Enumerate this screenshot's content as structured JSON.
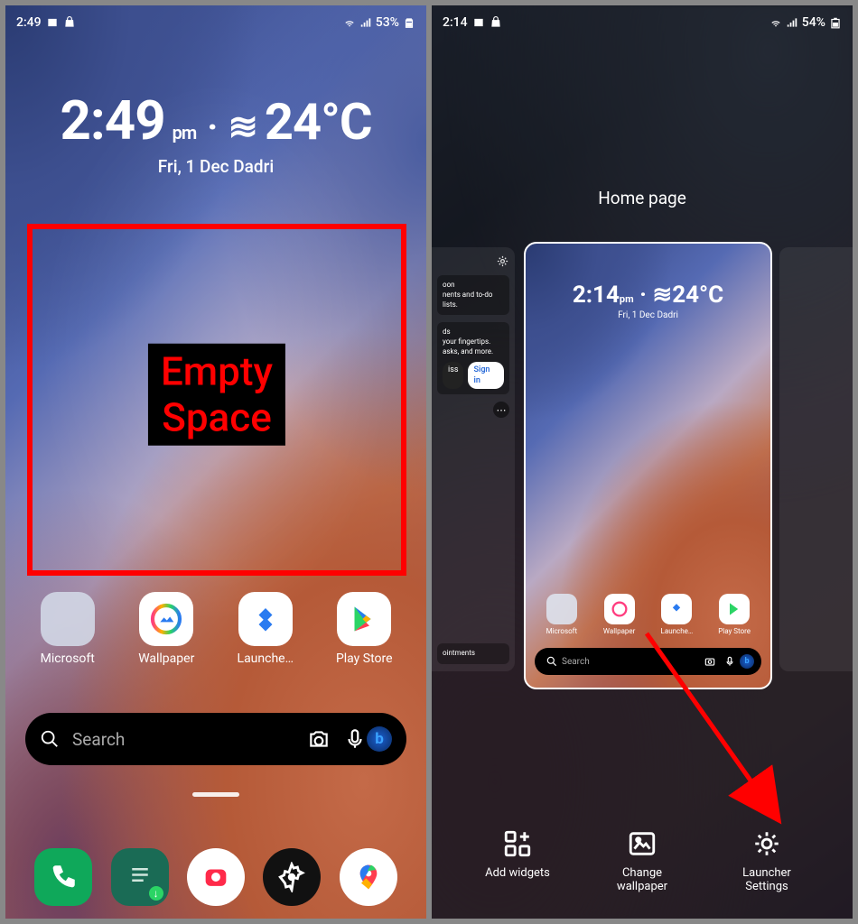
{
  "left": {
    "status": {
      "time": "2:49",
      "battery": "53%"
    },
    "clock": {
      "time": "2:49",
      "ampm": "pm",
      "temp": "24°C",
      "date": "Fri, 1 Dec  Dadri"
    },
    "empty_label": "Empty\nSpace",
    "apps": [
      {
        "label": "Microsoft"
      },
      {
        "label": "Wallpaper"
      },
      {
        "label": "Launche…"
      },
      {
        "label": "Play Store"
      }
    ],
    "search_placeholder": "Search"
  },
  "right": {
    "status": {
      "time": "2:14",
      "battery": "54%"
    },
    "title": "Home page",
    "feed": {
      "panel1_line1": "oon",
      "panel1_line2": "nents and to-do lists.",
      "panel2_title": "ds",
      "panel2_line2": "your fingertips.",
      "panel2_line3": "asks, and more.",
      "dismiss": "iss",
      "signin": "Sign in",
      "appt": "ointments"
    },
    "mini_clock": {
      "time": "2:14",
      "ampm": "pm",
      "temp": "24°C",
      "date": "Fri, 1 Dec  Dadri"
    },
    "mini_apps": [
      {
        "label": "Microsoft"
      },
      {
        "label": "Wallpaper"
      },
      {
        "label": "Launche…"
      },
      {
        "label": "Play Store"
      }
    ],
    "mini_search": "Search",
    "options": {
      "add_widgets": "Add widgets",
      "change_wallpaper": "Change\nwallpaper",
      "launcher_settings": "Launcher\nSettings"
    }
  }
}
